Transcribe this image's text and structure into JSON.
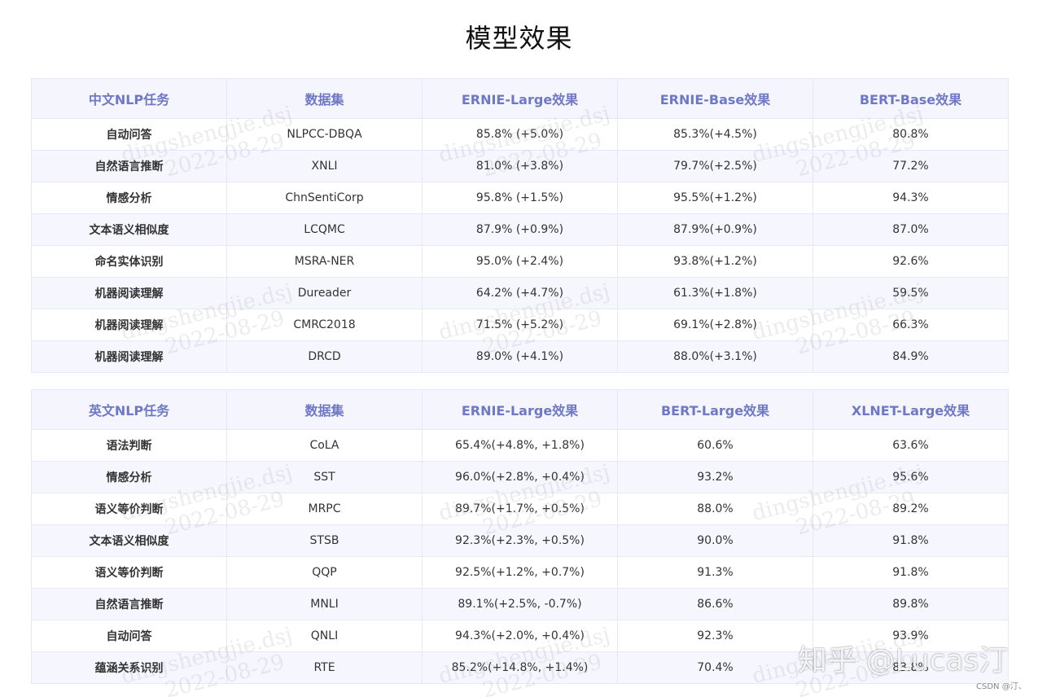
{
  "page_title": "模型效果",
  "table_cn": {
    "headers": [
      "中文NLP任务",
      "数据集",
      "ERNIE-Large效果",
      "ERNIE-Base效果",
      "BERT-Base效果"
    ],
    "rows": [
      [
        "自动问答",
        "NLPCC-DBQA",
        "85.8% (+5.0%)",
        "85.3%(+4.5%)",
        "80.8%"
      ],
      [
        "自然语言推断",
        "XNLI",
        "81.0% (+3.8%)",
        "79.7%(+2.5%)",
        "77.2%"
      ],
      [
        "情感分析",
        "ChnSentiCorp",
        "95.8% (+1.5%)",
        "95.5%(+1.2%)",
        "94.3%"
      ],
      [
        "文本语义相似度",
        "LCQMC",
        "87.9% (+0.9%)",
        "87.9%(+0.9%)",
        "87.0%"
      ],
      [
        "命名实体识别",
        "MSRA-NER",
        "95.0% (+2.4%)",
        "93.8%(+1.2%)",
        "92.6%"
      ],
      [
        "机器阅读理解",
        "Dureader",
        "64.2% (+4.7%)",
        "61.3%(+1.8%)",
        "59.5%"
      ],
      [
        "机器阅读理解",
        "CMRC2018",
        "71.5% (+5.2%)",
        "69.1%(+2.8%)",
        "66.3%"
      ],
      [
        "机器阅读理解",
        "DRCD",
        "89.0% (+4.1%)",
        "88.0%(+3.1%)",
        "84.9%"
      ]
    ]
  },
  "table_en": {
    "headers": [
      "英文NLP任务",
      "数据集",
      "ERNIE-Large效果",
      "BERT-Large效果",
      "XLNET-Large效果"
    ],
    "rows": [
      [
        "语法判断",
        "CoLA",
        "65.4%(+4.8%, +1.8%)",
        "60.6%",
        "63.6%"
      ],
      [
        "情感分析",
        "SST",
        "96.0%(+2.8%, +0.4%)",
        "93.2%",
        "95.6%"
      ],
      [
        "语义等价判断",
        "MRPC",
        "89.7%(+1.7%, +0.5%)",
        "88.0%",
        "89.2%"
      ],
      [
        "文本语义相似度",
        "STSB",
        "92.3%(+2.3%, +0.5%)",
        "90.0%",
        "91.8%"
      ],
      [
        "语义等价判断",
        "QQP",
        "92.5%(+1.2%, +0.7%)",
        "91.3%",
        "91.8%"
      ],
      [
        "自然语言推断",
        "MNLI",
        "89.1%(+2.5%, -0.7%)",
        "86.6%",
        "89.8%"
      ],
      [
        "自动问答",
        "QNLI",
        "94.3%(+2.0%, +0.4%)",
        "92.3%",
        "93.9%"
      ],
      [
        "蕴涵关系识别",
        "RTE",
        "85.2%(+14.8%, +1.4%)",
        "70.4%",
        "83.8%"
      ]
    ]
  },
  "watermark": {
    "name": "dingshengjie.dsj",
    "date": "2022-08-29"
  },
  "brand_watermark": "知乎 @Lucas汀",
  "csdn_credit": "CSDN @汀、",
  "colors": {
    "header_text": "#6f78c4",
    "header_bg": "#f4f5fd",
    "ernie_text": "#5563b8",
    "border": "#e6e8f2"
  }
}
